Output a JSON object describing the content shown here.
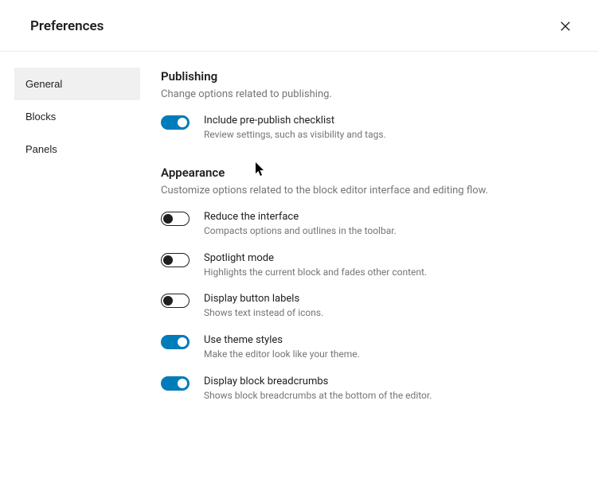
{
  "header": {
    "title": "Preferences"
  },
  "tabs": [
    {
      "label": "General",
      "active": true
    },
    {
      "label": "Blocks",
      "active": false
    },
    {
      "label": "Panels",
      "active": false
    }
  ],
  "sections": [
    {
      "title": "Publishing",
      "description": "Change options related to publishing.",
      "options": [
        {
          "label": "Include pre-publish checklist",
          "help": "Review settings, such as visibility and tags.",
          "enabled": true
        }
      ]
    },
    {
      "title": "Appearance",
      "description": "Customize options related to the block editor interface and editing flow.",
      "options": [
        {
          "label": "Reduce the interface",
          "help": "Compacts options and outlines in the toolbar.",
          "enabled": false
        },
        {
          "label": "Spotlight mode",
          "help": "Highlights the current block and fades other content.",
          "enabled": false
        },
        {
          "label": "Display button labels",
          "help": "Shows text instead of icons.",
          "enabled": false
        },
        {
          "label": "Use theme styles",
          "help": "Make the editor look like your theme.",
          "enabled": true
        },
        {
          "label": "Display block breadcrumbs",
          "help": "Shows block breadcrumbs at the bottom of the editor.",
          "enabled": true
        }
      ]
    }
  ]
}
